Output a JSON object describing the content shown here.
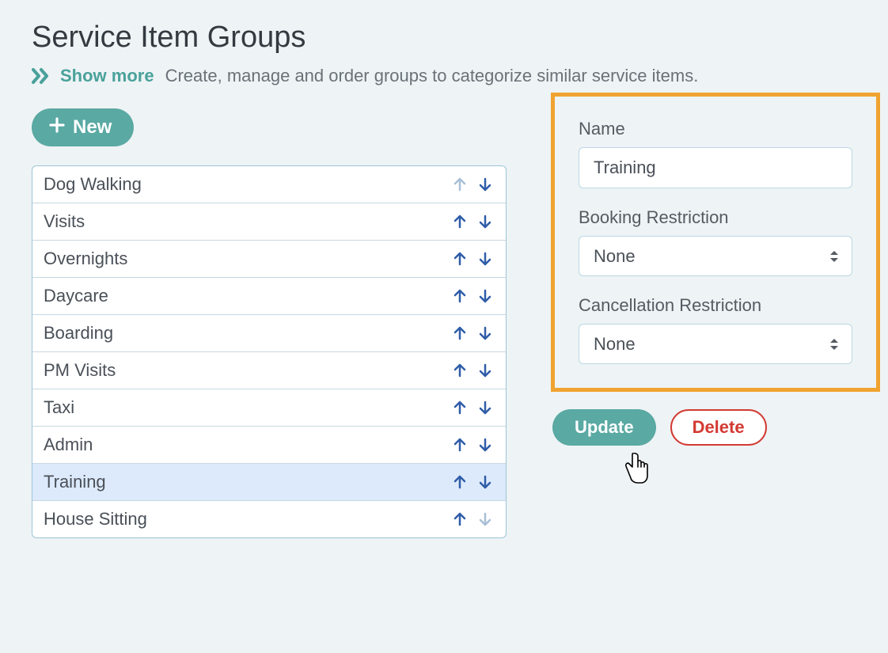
{
  "header": {
    "title": "Service Item Groups",
    "show_more_label": "Show more",
    "description": "Create, manage and order groups to categorize similar service items."
  },
  "toolbar": {
    "new_label": "New"
  },
  "groups": [
    {
      "label": "Dog Walking",
      "up_enabled": false,
      "down_enabled": true,
      "selected": false
    },
    {
      "label": "Visits",
      "up_enabled": true,
      "down_enabled": true,
      "selected": false
    },
    {
      "label": "Overnights",
      "up_enabled": true,
      "down_enabled": true,
      "selected": false
    },
    {
      "label": "Daycare",
      "up_enabled": true,
      "down_enabled": true,
      "selected": false
    },
    {
      "label": "Boarding",
      "up_enabled": true,
      "down_enabled": true,
      "selected": false
    },
    {
      "label": "PM Visits",
      "up_enabled": true,
      "down_enabled": true,
      "selected": false
    },
    {
      "label": "Taxi",
      "up_enabled": true,
      "down_enabled": true,
      "selected": false
    },
    {
      "label": "Admin",
      "up_enabled": true,
      "down_enabled": true,
      "selected": false
    },
    {
      "label": "Training",
      "up_enabled": true,
      "down_enabled": true,
      "selected": true
    },
    {
      "label": "House Sitting",
      "up_enabled": true,
      "down_enabled": false,
      "selected": false
    }
  ],
  "form": {
    "name_label": "Name",
    "name_value": "Training",
    "booking_label": "Booking Restriction",
    "booking_value": "None",
    "cancellation_label": "Cancellation Restriction",
    "cancellation_value": "None",
    "update_label": "Update",
    "delete_label": "Delete"
  }
}
